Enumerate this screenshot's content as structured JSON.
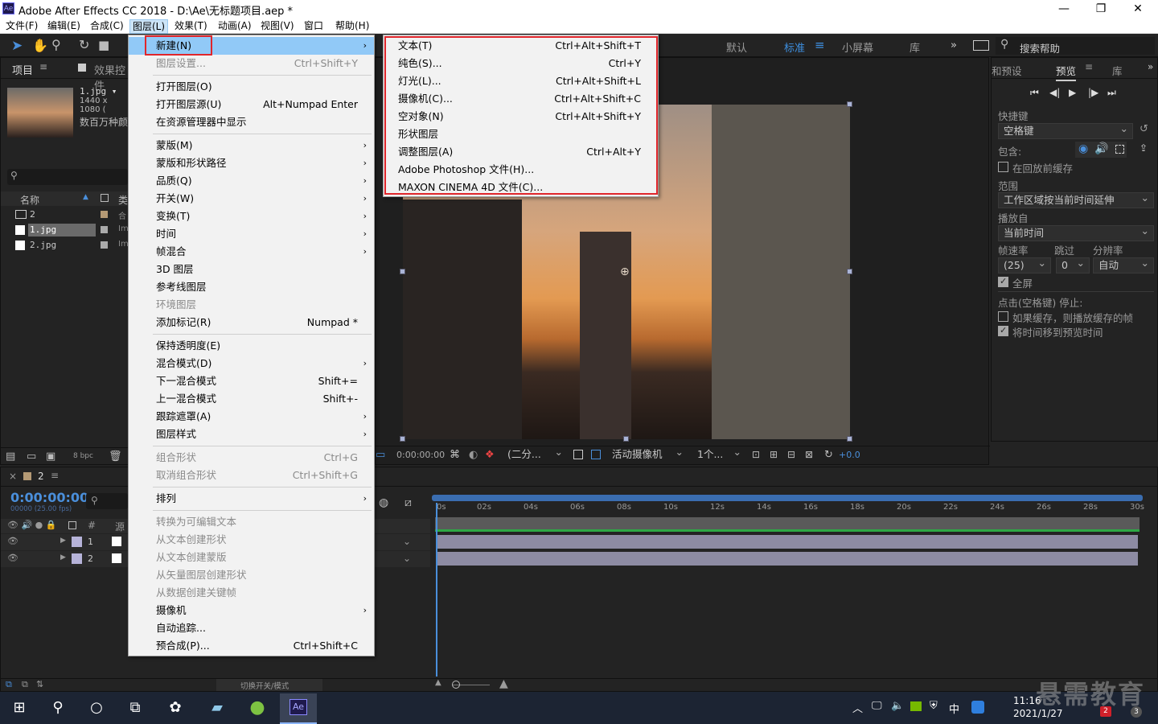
{
  "window": {
    "title": "Adobe After Effects CC 2018 - D:\\Ae\\无标题项目.aep *",
    "app_icon": "Ae",
    "minimize": "—",
    "maximize": "❐",
    "close": "✕"
  },
  "menubar": [
    "文件(F)",
    "编辑(E)",
    "合成(C)",
    "图层(L)",
    "效果(T)",
    "动画(A)",
    "视图(V)",
    "窗口",
    "帮助(H)"
  ],
  "workspaces": {
    "items": [
      "默认",
      "标准",
      "小屏幕",
      "库"
    ],
    "more": "»",
    "search": "搜索帮助"
  },
  "project": {
    "tab": "项目",
    "tab2": "效果控件",
    "file_name": "1.jpg ▾",
    "file_info": "1440 x 1080 (",
    "file_colors": "数百万种颜",
    "col_name": "名称",
    "col_type": "类",
    "rows": [
      {
        "name": "2",
        "type": "合"
      },
      {
        "name": "1.jpg",
        "type": "Im"
      },
      {
        "name": "2.jpg",
        "type": "Im"
      }
    ],
    "bpc": "8 bpc"
  },
  "layer_menu": {
    "items": [
      {
        "label": "新建(N)",
        "shortcut": "",
        "arrow": true,
        "dis": false,
        "hl": true
      },
      {
        "label": "图层设置...",
        "shortcut": "Ctrl+Shift+Y",
        "dis": true
      },
      {
        "sep": true
      },
      {
        "label": "打开图层(O)",
        "shortcut": ""
      },
      {
        "label": "打开图层源(U)",
        "shortcut": "Alt+Numpad Enter"
      },
      {
        "label": "在资源管理器中显示",
        "shortcut": ""
      },
      {
        "sep": true
      },
      {
        "label": "蒙版(M)",
        "arrow": true
      },
      {
        "label": "蒙版和形状路径",
        "arrow": true
      },
      {
        "label": "品质(Q)",
        "arrow": true
      },
      {
        "label": "开关(W)",
        "arrow": true
      },
      {
        "label": "变换(T)",
        "arrow": true
      },
      {
        "label": "时间",
        "arrow": true
      },
      {
        "label": "帧混合",
        "arrow": true
      },
      {
        "label": "3D 图层"
      },
      {
        "label": "参考线图层"
      },
      {
        "label": "环境图层",
        "dis": true
      },
      {
        "label": "添加标记(R)",
        "shortcut": "Numpad *"
      },
      {
        "sep": true
      },
      {
        "label": "保持透明度(E)"
      },
      {
        "label": "混合模式(D)",
        "arrow": true
      },
      {
        "label": "下一混合模式",
        "shortcut": "Shift+="
      },
      {
        "label": "上一混合模式",
        "shortcut": "Shift+-"
      },
      {
        "label": "跟踪遮罩(A)",
        "arrow": true
      },
      {
        "label": "图层样式",
        "arrow": true
      },
      {
        "sep": true
      },
      {
        "label": "组合形状",
        "shortcut": "Ctrl+G",
        "dis": true
      },
      {
        "label": "取消组合形状",
        "shortcut": "Ctrl+Shift+G",
        "dis": true
      },
      {
        "sep": true
      },
      {
        "label": "排列",
        "arrow": true
      },
      {
        "sep": true
      },
      {
        "label": "转换为可编辑文本",
        "dis": true
      },
      {
        "label": "从文本创建形状",
        "dis": true
      },
      {
        "label": "从文本创建蒙版",
        "dis": true
      },
      {
        "label": "从矢量图层创建形状",
        "dis": true
      },
      {
        "label": "从数据创建关键帧",
        "dis": true
      },
      {
        "label": "摄像机",
        "arrow": true
      },
      {
        "label": "自动追踪..."
      },
      {
        "label": "预合成(P)...",
        "shortcut": "Ctrl+Shift+C"
      }
    ]
  },
  "new_submenu": [
    {
      "label": "文本(T)",
      "shortcut": "Ctrl+Alt+Shift+T"
    },
    {
      "label": "纯色(S)...",
      "shortcut": "Ctrl+Y"
    },
    {
      "label": "灯光(L)...",
      "shortcut": "Ctrl+Alt+Shift+L"
    },
    {
      "label": "摄像机(C)...",
      "shortcut": "Ctrl+Alt+Shift+C"
    },
    {
      "label": "空对象(N)",
      "shortcut": "Ctrl+Alt+Shift+Y"
    },
    {
      "label": "形状图层",
      "shortcut": ""
    },
    {
      "label": "调整图层(A)",
      "shortcut": "Ctrl+Alt+Y"
    },
    {
      "label": "Adobe Photoshop 文件(H)...",
      "shortcut": ""
    },
    {
      "label": "MAXON CINEMA 4D 文件(C)...",
      "shortcut": ""
    }
  ],
  "comp_footer": {
    "time": "0:00:00:00",
    "resolution": "(二分...",
    "camera": "活动摄像机",
    "views": "1个...",
    "offset": "+0.0"
  },
  "right_panel": {
    "tab1": "和预设",
    "tab2": "预览",
    "tab3": "库",
    "shortcut_label": "快捷键",
    "shortcut_value": "空格键",
    "include_label": "包含:",
    "cache_before": "在回放前缓存",
    "range_label": "范围",
    "range_value": "工作区域按当前时间延伸",
    "play_from_label": "播放自",
    "play_from_value": "当前时间",
    "fps_label": "帧速率",
    "skip_label": "跳过",
    "res_label": "分辨率",
    "fps_value": "(25)",
    "skip_value": "0",
    "res_value": "自动",
    "fullscreen": "全屏",
    "stop_label": "点击(空格键) 停止:",
    "if_cached": "如果缓存，则播放缓存的帧",
    "move_time": "将时间移到预览时间"
  },
  "timeline": {
    "tab": "2",
    "timecode": "0:00:00:00",
    "fps": "00000 (25.00 fps)",
    "col_num": "#",
    "col_src": "源",
    "layers": [
      "1",
      "2"
    ],
    "ticks": [
      "0s",
      "02s",
      "04s",
      "06s",
      "08s",
      "10s",
      "12s",
      "14s",
      "16s",
      "18s",
      "20s",
      "22s",
      "24s",
      "26s",
      "28s",
      "30s"
    ],
    "footer": "切换开关/模式"
  },
  "taskbar": {
    "time": "11:16",
    "date": "2021/1/27",
    "ime": "中",
    "watermark": "悬需教育",
    "badge_mail": "2",
    "badge_notif": "3"
  }
}
